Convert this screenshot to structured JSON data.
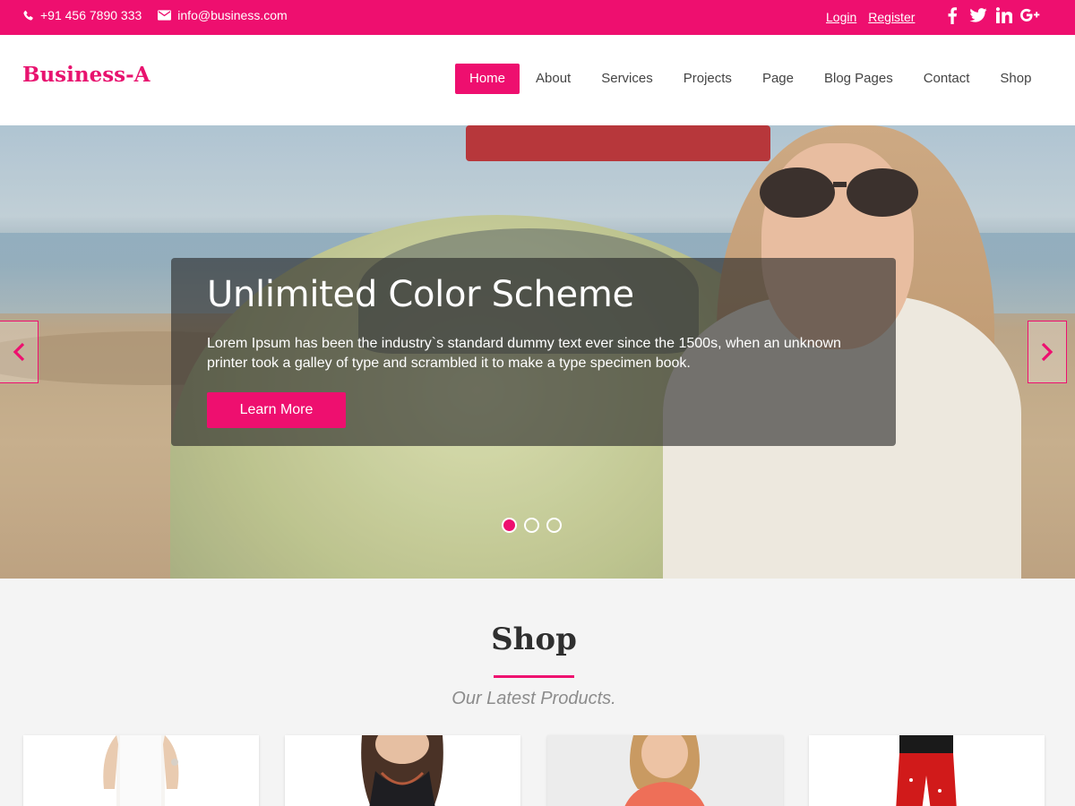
{
  "topbar": {
    "phone": "+91 456 7890 333",
    "email": "info@business.com",
    "login": "Login",
    "register": "Register",
    "social": [
      "facebook-icon",
      "twitter-icon",
      "linkedin-icon",
      "google-plus-icon"
    ]
  },
  "header": {
    "logo": "Business-A",
    "nav": [
      "Home",
      "About",
      "Services",
      "Projects",
      "Page",
      "Blog Pages",
      "Contact",
      "Shop"
    ],
    "active_nav": "Home"
  },
  "hero": {
    "title": "Unlimited Color Scheme",
    "text": "Lorem Ipsum has been the industry`s standard dummy text ever since the 1500s, when an unknown printer took a galley of type and scrambled it to make a type specimen book.",
    "button": "Learn More",
    "slides": 3,
    "active_slide": 1
  },
  "shop": {
    "title": "Shop",
    "subtitle": "Our Latest Products."
  },
  "colors": {
    "accent": "#ee0f6f",
    "background": "#f4f4f4"
  }
}
